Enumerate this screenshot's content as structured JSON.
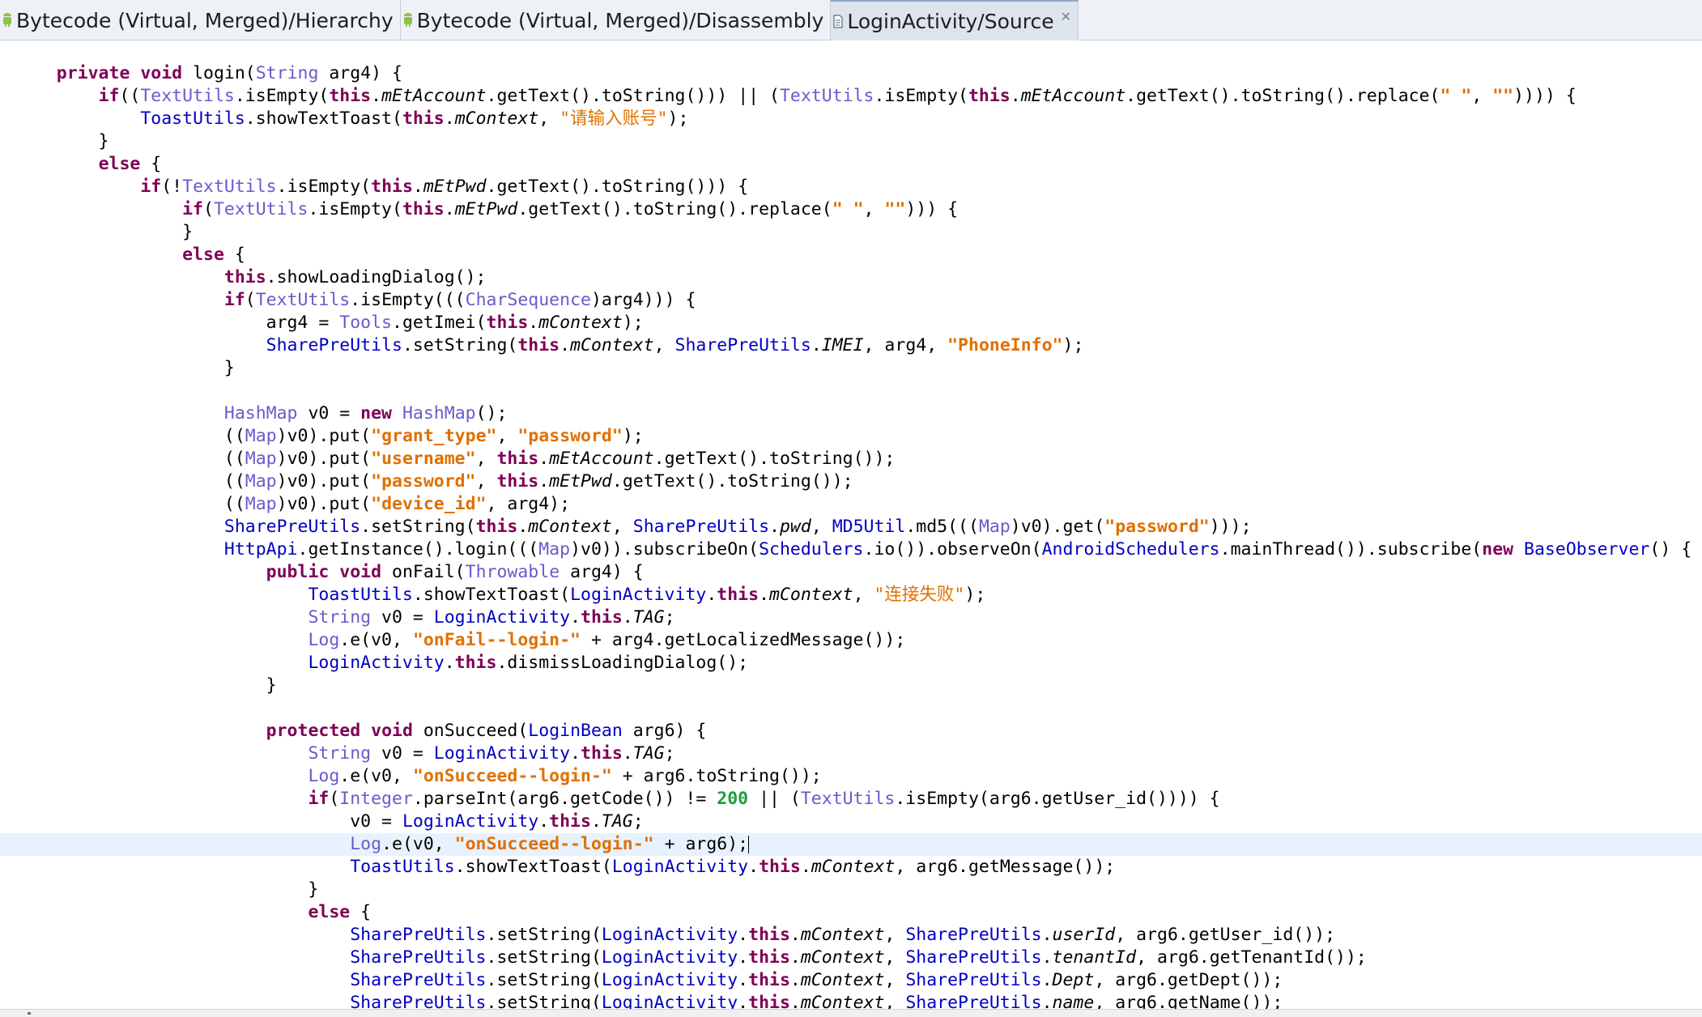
{
  "tabs": [
    {
      "label": "Bytecode (Virtual, Merged)/Hierarchy",
      "icon": "android-icon",
      "active": false
    },
    {
      "label": "Bytecode (Virtual, Merged)/Disassembly",
      "icon": "android-icon",
      "active": false
    },
    {
      "label": "LoginActivity/Source",
      "icon": "source-file-icon",
      "active": true,
      "close": "✕"
    }
  ],
  "colors": {
    "keyword": "#7f0055",
    "type": "#6a5acd",
    "class_ref": "#0000c0",
    "string": "#e07000",
    "number": "#1b9e3e",
    "current_line": "#e8f2fe"
  },
  "editor": {
    "current_line": 34,
    "lines": [
      "    private void login(String arg4) {",
      "        if((TextUtils.isEmpty(this.mEtAccount.getText().toString())) || (TextUtils.isEmpty(this.mEtAccount.getText().toString().replace(\" \", \"\")))) {",
      "            ToastUtils.showTextToast(this.mContext, \"请输入账号\");",
      "        }",
      "        else {",
      "            if(!TextUtils.isEmpty(this.mEtPwd.getText().toString())) {",
      "                if(TextUtils.isEmpty(this.mEtPwd.getText().toString().replace(\" \", \"\"))) {",
      "                }",
      "                else {",
      "                    this.showLoadingDialog();",
      "                    if(TextUtils.isEmpty(((CharSequence)arg4))) {",
      "                        arg4 = Tools.getImei(this.mContext);",
      "                        SharePreUtils.setString(this.mContext, SharePreUtils.IMEI, arg4, \"PhoneInfo\");",
      "                    }",
      "",
      "                    HashMap v0 = new HashMap();",
      "                    ((Map)v0).put(\"grant_type\", \"password\");",
      "                    ((Map)v0).put(\"username\", this.mEtAccount.getText().toString());",
      "                    ((Map)v0).put(\"password\", this.mEtPwd.getText().toString());",
      "                    ((Map)v0).put(\"device_id\", arg4);",
      "                    SharePreUtils.setString(this.mContext, SharePreUtils.pwd, MD5Util.md5(((Map)v0).get(\"password\")));",
      "                    HttpApi.getInstance().login(((Map)v0)).subscribeOn(Schedulers.io()).observeOn(AndroidSchedulers.mainThread()).subscribe(new BaseObserver() {",
      "                        public void onFail(Throwable arg4) {",
      "                            ToastUtils.showTextToast(LoginActivity.this.mContext, \"连接失败\");",
      "                            String v0 = LoginActivity.this.TAG;",
      "                            Log.e(v0, \"onFail--login-\" + arg4.getLocalizedMessage());",
      "                            LoginActivity.this.dismissLoadingDialog();",
      "                        }",
      "",
      "                        protected void onSucceed(LoginBean arg6) {",
      "                            String v0 = LoginActivity.this.TAG;",
      "                            Log.e(v0, \"onSucceed--login-\" + arg6.toString());",
      "                            if(Integer.parseInt(arg6.getCode()) != 200 || (TextUtils.isEmpty(arg6.getUser_id()))) {",
      "                                v0 = LoginActivity.this.TAG;",
      "                                Log.e(v0, \"onSucceed--login-\" + arg6);",
      "                                ToastUtils.showTextToast(LoginActivity.this.mContext, arg6.getMessage());",
      "                            }",
      "                            else {",
      "                                SharePreUtils.setString(LoginActivity.this.mContext, SharePreUtils.userId, arg6.getUser_id());",
      "                                SharePreUtils.setString(LoginActivity.this.mContext, SharePreUtils.tenantId, arg6.getTenantId());",
      "                                SharePreUtils.setString(LoginActivity.this.mContext, SharePreUtils.Dept, arg6.getDept());",
      "                                SharePreUtils.setString(LoginActivity.this.mContext, SharePreUtils.name, arg6.getName());"
    ]
  }
}
